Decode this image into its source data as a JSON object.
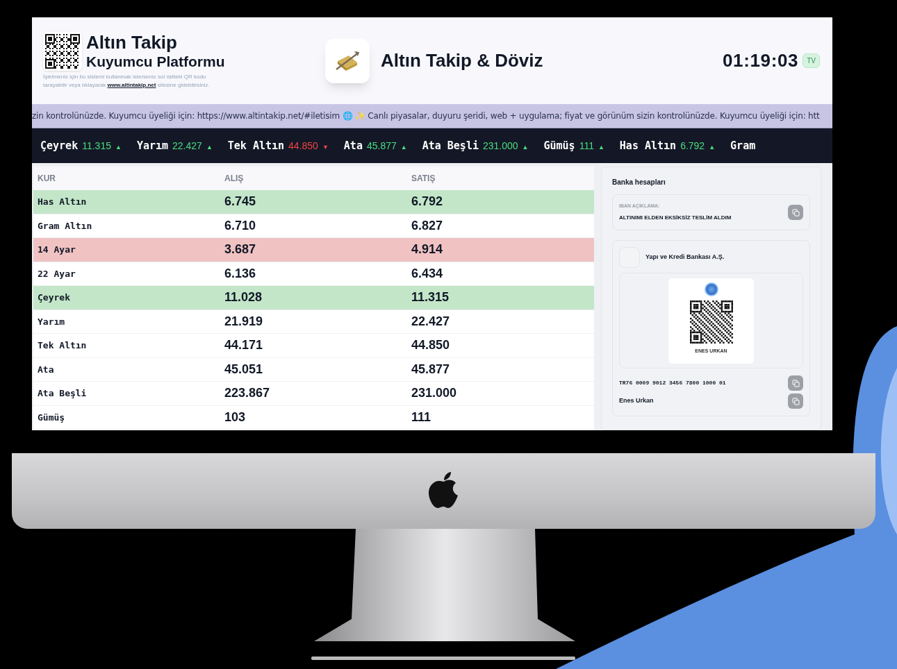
{
  "header": {
    "brand_title": "Altın Takip",
    "brand_subtitle": "Kuyumcu Platformu",
    "description_before": "İşletmeniz için bu sistemi kullanmak isterseniz sol üstteki QR kodu tarayabilir veya tıklayarak",
    "description_link": "www.altintakip.net",
    "description_after": "sitesine gidebilirsiniz.",
    "app_title": "Altın Takip & Döviz",
    "clock": "01:19:03",
    "tv_badge": "TV"
  },
  "announcement": "zin kontrolünüzde. Kuyumcu üyeliği için: https://www.altintakip.net/#iletisim 🌐 ✨ Canlı piyasalar, duyuru şeridi, web + uygulama; fiyat ve görünüm sizin kontrolünüzde. Kuyumcu üyeliği için: htt",
  "ticker": [
    {
      "name": "Çeyrek",
      "value": "11.315",
      "arrow": "▲",
      "color": "#4ade80"
    },
    {
      "name": "Yarım",
      "value": "22.427",
      "arrow": "▲",
      "color": "#4ade80"
    },
    {
      "name": "Tek Altın",
      "value": "44.850",
      "arrow": "▼",
      "color": "#ef4444"
    },
    {
      "name": "Ata",
      "value": "45.877",
      "arrow": "▲",
      "color": "#4ade80"
    },
    {
      "name": "Ata Beşli",
      "value": "231.000",
      "arrow": "▲",
      "color": "#4ade80"
    },
    {
      "name": "Gümüş",
      "value": "111",
      "arrow": "▲",
      "color": "#4ade80"
    },
    {
      "name": "Has Altın",
      "value": "6.792",
      "arrow": "▲",
      "color": "#4ade80"
    },
    {
      "name": "Gram"
    }
  ],
  "table": {
    "columns": [
      "KUR",
      "ALIŞ",
      "SATIŞ"
    ],
    "rows": [
      {
        "name": "Has Altın",
        "buy": "6.745",
        "sell": "6.792",
        "color": "#c3e6c8"
      },
      {
        "name": "Gram Altın",
        "buy": "6.710",
        "sell": "6.827"
      },
      {
        "name": "14 Ayar",
        "buy": "3.687",
        "sell": "4.914",
        "color": "#f0c2c2"
      },
      {
        "name": "22 Ayar",
        "buy": "6.136",
        "sell": "6.434"
      },
      {
        "name": "Çeyrek",
        "buy": "11.028",
        "sell": "11.315",
        "color": "#c3e6c8"
      },
      {
        "name": "Yarım",
        "buy": "21.919",
        "sell": "22.427"
      },
      {
        "name": "Tek Altın",
        "buy": "44.171",
        "sell": "44.850"
      },
      {
        "name": "Ata",
        "buy": "45.051",
        "sell": "45.877"
      },
      {
        "name": "Ata Beşli",
        "buy": "223.867",
        "sell": "231.000"
      },
      {
        "name": "Gümüş",
        "buy": "103",
        "sell": "111"
      }
    ]
  },
  "bank": {
    "title": "Banka hesapları",
    "note_label": "IBAN AÇIKLAMA:",
    "note": "ALTINIMI ELDEN EKSİKSİZ TESLİM ALDIM",
    "bank_name": "Yapı ve Kredi Bankası A.Ş.",
    "qr_caption": "ENES URKAN",
    "iban": "TR76 0009 9012 3456 7800 1000 01",
    "holder": "Enes Urkan"
  }
}
